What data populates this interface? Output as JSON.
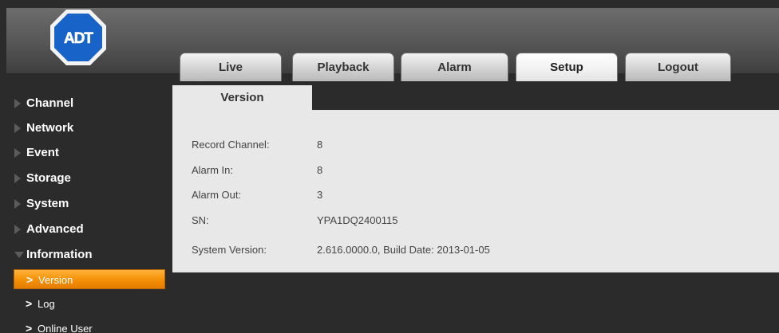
{
  "brand": {
    "logo_text": "ADT",
    "accent": "#1763c8"
  },
  "tabs": [
    {
      "label": "Live"
    },
    {
      "label": "Playback"
    },
    {
      "label": "Alarm"
    },
    {
      "label": "Setup",
      "active": true
    },
    {
      "label": "Logout"
    }
  ],
  "sidebar": {
    "items": [
      {
        "label": "Channel"
      },
      {
        "label": "Network"
      },
      {
        "label": "Event"
      },
      {
        "label": "Storage"
      },
      {
        "label": "System"
      },
      {
        "label": "Advanced"
      },
      {
        "label": "Information",
        "expanded": true
      }
    ],
    "subitems": [
      {
        "label": "Version",
        "active": true
      },
      {
        "label": "Log"
      },
      {
        "label": "Online User"
      }
    ],
    "chevron": ">"
  },
  "content": {
    "tab_title": "Version",
    "rows": [
      {
        "label": "Record Channel:",
        "value": "8"
      },
      {
        "label": "Alarm In:",
        "value": "8"
      },
      {
        "label": "Alarm Out:",
        "value": "3"
      },
      {
        "label": "SN:",
        "value": "YPA1DQ2400115"
      },
      {
        "label": "System Version:",
        "value": "2.616.0000.0, Build Date: 2013-01-05"
      }
    ]
  },
  "colors": {
    "background": "#2b2b2b",
    "panel": "#e8e8e8",
    "active_item": "#f48f06"
  }
}
